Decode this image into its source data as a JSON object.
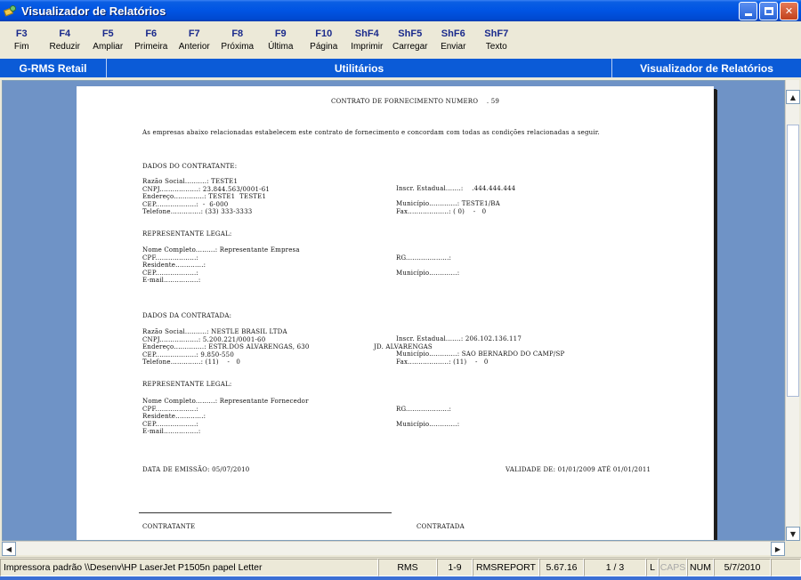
{
  "window": {
    "title": "Visualizador de Relatórios"
  },
  "toolbar": [
    {
      "key": "F3",
      "label": "Fim"
    },
    {
      "key": "F4",
      "label": "Reduzir"
    },
    {
      "key": "F5",
      "label": "Ampliar"
    },
    {
      "key": "F6",
      "label": "Primeira"
    },
    {
      "key": "F7",
      "label": "Anterior"
    },
    {
      "key": "F8",
      "label": "Próxima"
    },
    {
      "key": "F9",
      "label": "Última"
    },
    {
      "key": "F10",
      "label": "Página"
    },
    {
      "key": "ShF4",
      "label": "Imprimir"
    },
    {
      "key": "ShF5",
      "label": "Carregar"
    },
    {
      "key": "ShF6",
      "label": "Enviar"
    },
    {
      "key": "ShF7",
      "label": "Texto"
    }
  ],
  "band": {
    "left": "G-RMS Retail",
    "center": "Utilitários",
    "right": "Visualizador de Relatórios"
  },
  "report": {
    "title": "CONTRATO DE FORNECIMENTO NUMERO    . 59",
    "intro": "As empresas abaixo relacionadas estabelecem este contrato de fornecimento e concordam com todas as condições relacionadas a seguir.",
    "contratante_heading": "DADOS DO CONTRATANTE:",
    "contratante_left": [
      "Razão Social..........: TESTE1",
      "CNPJ..................: 23.844.563/0001-61",
      "Endereço..............: TESTE1  TESTE1",
      "CEP...................:  -  6-000",
      "Telefone..............: (33) 333-3333"
    ],
    "contratante_right": [
      "Inscr. Estadual.......:    .444.444.444",
      "",
      "Município.............: TESTE1/BA",
      "Fax...................: ( 0)    -   0"
    ],
    "rep_heading": "REPRESENTANTE LEGAL:",
    "rep1_left": [
      "Nome Completo.........: Representante Empresa",
      "CPF...................:",
      "Residente.............:",
      "CEP...................:",
      "E-mail................:"
    ],
    "rep1_right": [
      "",
      "RG....................:",
      "",
      "Município.............:"
    ],
    "contratada_heading": "DADOS DA CONTRATADA:",
    "contratada_left": [
      "Razão Social..........: NESTLE BRASIL LTDA",
      "CNPJ..................: 5.200.221/0001-60",
      "Endereço..............: ESTR.DOS ALVARENGAS, 630",
      "CEP...................: 9.850-550",
      "Telefone..............: (11)    -   0"
    ],
    "contratada_right": [
      "Inscr. Estadual.......: 206.102.136.117",
      "JD. ALVARENGAS",
      "Município.............: SAO BERNARDO DO CAMP/SP",
      "Fax...................: (11)    -   0"
    ],
    "rep2_left": [
      "Nome Completo.........: Representante Fornecedor",
      "CPF...................:",
      "Residente.............:",
      "CEP...................:",
      "E-mail................:"
    ],
    "rep2_right": [
      "",
      "RG....................:",
      "",
      "Município.............:"
    ],
    "emissao": "DATA DE EMISSÃO: 05/07/2010",
    "validade": "VALIDADE DE: 01/01/2009 ATÉ 01/01/2011",
    "sign_left": "CONTRATANTE",
    "sign_right": "CONTRATADA"
  },
  "status": {
    "printer": "Impressora padrão \\\\Desenv\\HP LaserJet P1505n papel Letter",
    "module": "RMS",
    "range": "1-9",
    "report": "RMSREPORT",
    "version": "5.67.16",
    "page": "1 / 3",
    "l": "L",
    "caps": "CAPS",
    "num": "NUM",
    "date": "5/7/2010"
  }
}
